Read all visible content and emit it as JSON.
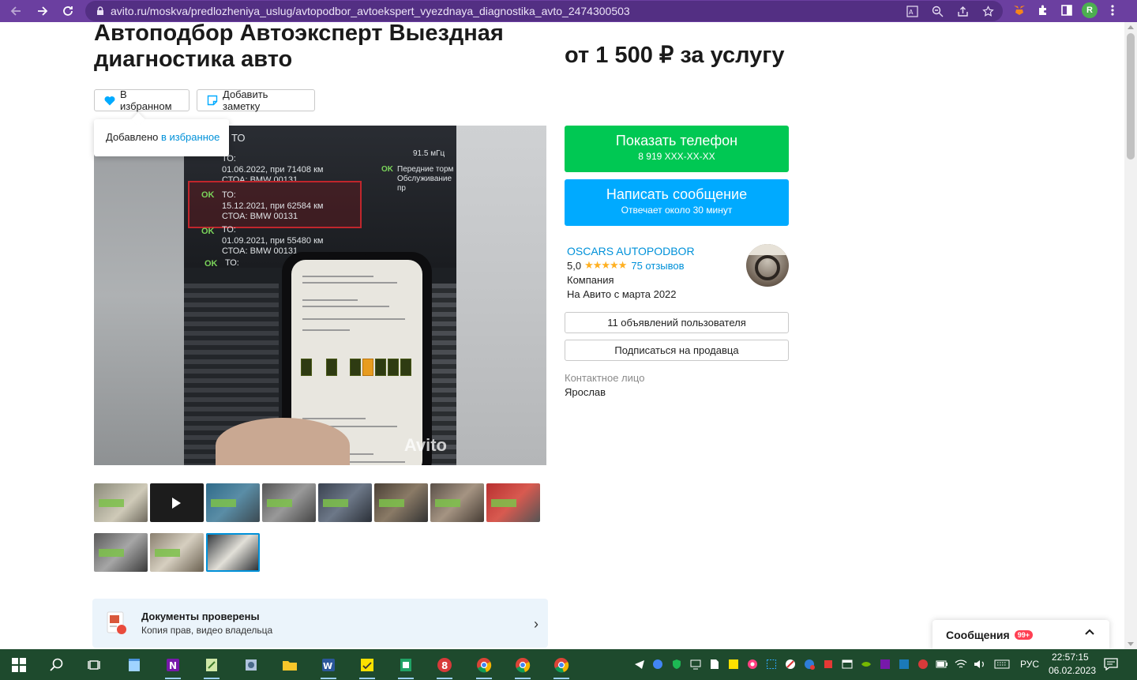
{
  "browser": {
    "url": "avito.ru/moskva/predlozheniya_uslug/avtopodbor_avtoekspert_vyezdnaya_diagnostika_avto_2474300503",
    "profile_initial": "R"
  },
  "listing": {
    "title": "Автоподбор Автоэксперт Выездная диагностика авто",
    "price": "от 1 500 ₽ за услугу",
    "favorite_label": "В избранном",
    "note_label": "Добавить заметку",
    "tooltip_text": "Добавлено ",
    "tooltip_link": "в избранное",
    "watermark": "Avito"
  },
  "photo_text": {
    "header": "ТО",
    "line1a": "ТО:",
    "line1b": "01.06.2022, при 71408 км",
    "line1c": "СТОА: BMW 00131",
    "ok": "OK",
    "line2a": "ТО:",
    "line2b": "15.12.2021, при 62584 км",
    "line2c": "СТОА: BMW 00131",
    "line3a": "ТО:",
    "line3b": "01.09.2021, при 55480 км",
    "line3c": "СТОА: BMW 00131",
    "line4a": "ТО:",
    "right1": "91.5 мГц",
    "right2": "Передние торм",
    "right3": "Обслуживание пр"
  },
  "actions": {
    "show_phone": "Показать телефон",
    "phone_masked": "8 919 XXX-XX-XX",
    "write_message": "Написать сообщение",
    "reply_time": "Отвечает около 30 минут"
  },
  "seller": {
    "name": "OSCARS AUTOPODBOR",
    "rating": "5,0",
    "stars": "★★★★★",
    "reviews": "75 отзывов",
    "type": "Компания",
    "since": "На Авито с марта 2022",
    "listings_btn": "11 объявлений пользователя",
    "subscribe_btn": "Подписаться на продавца",
    "contact_label": "Контактное лицо",
    "contact_name": "Ярослав"
  },
  "docs": {
    "title": "Документы проверены",
    "subtitle": "Копия прав, видео владельца"
  },
  "messages": {
    "label": "Сообщения",
    "badge": "99+"
  },
  "taskbar": {
    "lang": "РУС",
    "time": "22:57:15",
    "date": "06.02.2023"
  }
}
